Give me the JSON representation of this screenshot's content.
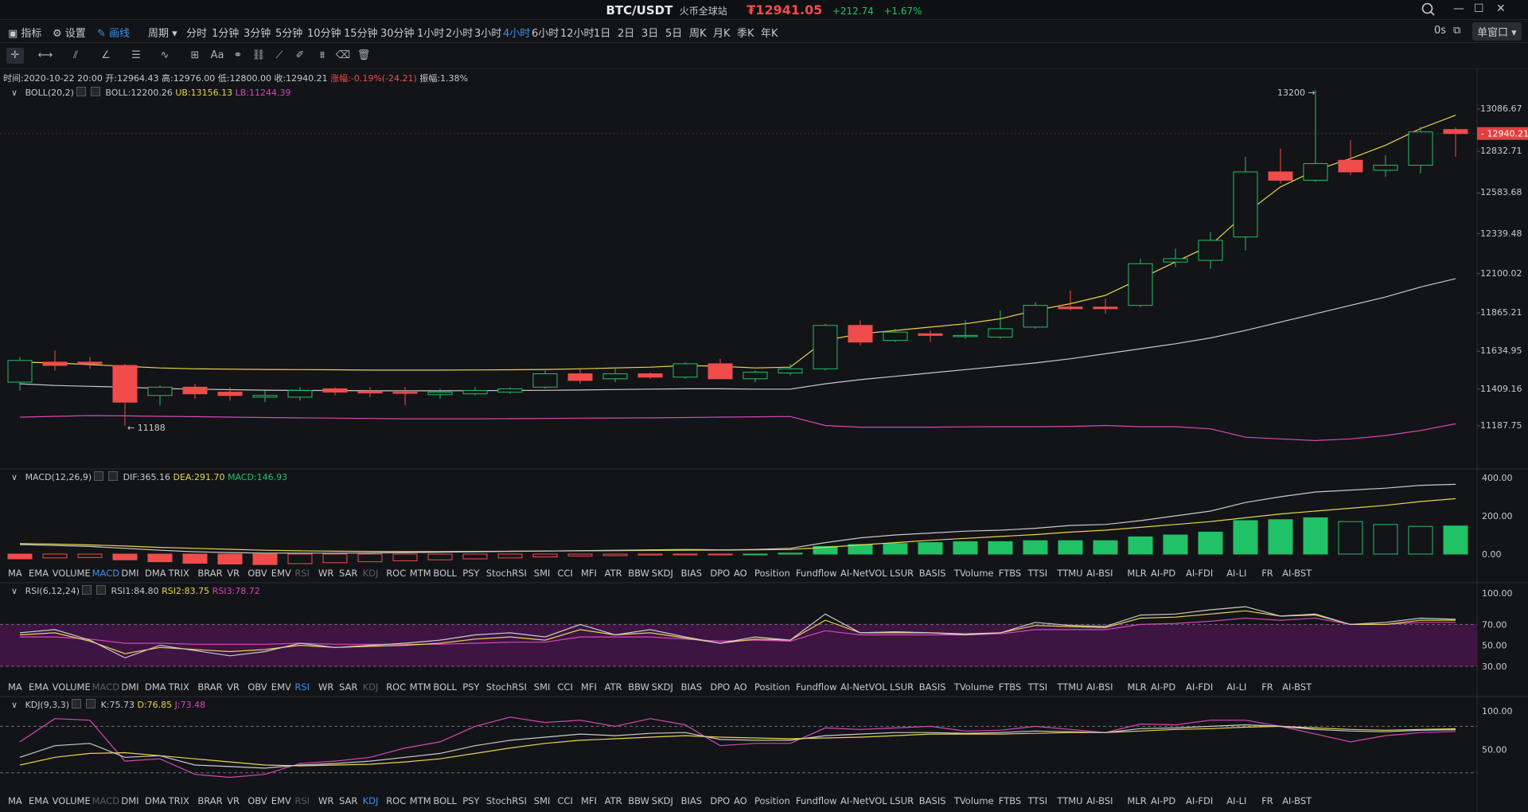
{
  "header": {
    "pair": "BTC/USDT",
    "exchange": "火币全球站",
    "price": "₮12941.05",
    "change": "+212.74",
    "change_pct": "+1.67%"
  },
  "toolbar": {
    "indicators": "指标",
    "settings": "设置",
    "draw": "画线",
    "period": "周期",
    "periods": [
      "分时",
      "1分钟",
      "3分钟",
      "5分钟",
      "10分钟",
      "15分钟",
      "30分钟",
      "1小时",
      "2小时",
      "3小时",
      "4小时",
      "6小时",
      "12小时",
      "1日",
      "2日",
      "3日",
      "5日",
      "周K",
      "月K",
      "季K",
      "年K"
    ],
    "active_period": "4小时",
    "timer": "0s",
    "window_mode": "单窗口"
  },
  "info_bar": {
    "time": "时间:2020-10-22 20:00",
    "open": "开:12964.43",
    "high": "高:12976.00",
    "low": "低:12800.00",
    "close": "收:12940.21",
    "change": "涨幅:-0.19%(-24.21)",
    "amplitude": "振幅:1.38%"
  },
  "boll": {
    "name": "BOLL(20,2)",
    "mid": "BOLL:12200.26",
    "ub": "UB:13156.13",
    "lb": "LB:11244.39",
    "high_marker": "13200",
    "low_marker": "11188",
    "current_price": "12940.21",
    "axis": [
      "13086.67",
      "12832.71",
      "12583.68",
      "12339.48",
      "12100.02",
      "11865.21",
      "11634.95",
      "11409.16",
      "11187.75"
    ]
  },
  "macd": {
    "name": "MACD(12,26,9)",
    "dif": "DIF:365.16",
    "dea": "DEA:291.70",
    "macd": "MACD:146.93",
    "axis": [
      "400.00",
      "200.00",
      "0.00"
    ]
  },
  "rsi": {
    "name": "RSI(6,12,24)",
    "rsi1": "RSI1:84.80",
    "rsi2": "RSI2:83.75",
    "rsi3": "RSI3:78.72",
    "axis": [
      "100.00",
      "70.00",
      "50.00",
      "30.00"
    ]
  },
  "kdj": {
    "name": "KDJ(9,3,3)",
    "k": "K:75.73",
    "d": "D:76.85",
    "j": "J:73.48",
    "axis": [
      "100.00",
      "50.00"
    ]
  },
  "indicator_tabs": [
    "MA",
    "EMA",
    "VOLUME",
    "MACD",
    "DMI",
    "DMA",
    "TRIX",
    "BRAR",
    "VR",
    "OBV",
    "EMV",
    "RSI",
    "WR",
    "SAR",
    "KDJ",
    "ROC",
    "MTM",
    "BOLL",
    "PSY",
    "StochRSI",
    "SMI",
    "CCI",
    "MFI",
    "ATR",
    "BBW",
    "SKDJ",
    "BIAS",
    "DPO",
    "AO",
    "Position",
    "Fundflow",
    "AI-NetVOL",
    "LSUR",
    "BASIS",
    "TVolume",
    "FTBS",
    "TTSI",
    "TTMU",
    "AI-BSI",
    "MLR",
    "AI-PD",
    "AI-FDI",
    "AI-LI",
    "FR",
    "AI-BST"
  ],
  "colors": {
    "up": "#20c167",
    "down": "#f04c4c",
    "mid": "#e8d44d",
    "upper": "#c8cace",
    "lower": "#d648b8",
    "accent": "#3c8ff0"
  },
  "candles": [
    {
      "o": 11450,
      "h": 11600,
      "l": 11400,
      "c": 11580
    },
    {
      "o": 11570,
      "h": 11640,
      "l": 11520,
      "c": 11550
    },
    {
      "o": 11570,
      "h": 11600,
      "l": 11530,
      "c": 11560
    },
    {
      "o": 11550,
      "h": 11560,
      "l": 11188,
      "c": 11330
    },
    {
      "o": 11370,
      "h": 11430,
      "l": 11310,
      "c": 11420
    },
    {
      "o": 11420,
      "h": 11440,
      "l": 11350,
      "c": 11380
    },
    {
      "o": 11390,
      "h": 11420,
      "l": 11340,
      "c": 11370
    },
    {
      "o": 11360,
      "h": 11400,
      "l": 11330,
      "c": 11370
    },
    {
      "o": 11360,
      "h": 11420,
      "l": 11340,
      "c": 11400
    },
    {
      "o": 11410,
      "h": 11420,
      "l": 11370,
      "c": 11390
    },
    {
      "o": 11395,
      "h": 11420,
      "l": 11360,
      "c": 11385
    },
    {
      "o": 11390,
      "h": 11420,
      "l": 11310,
      "c": 11385
    },
    {
      "o": 11375,
      "h": 11410,
      "l": 11350,
      "c": 11390
    },
    {
      "o": 11380,
      "h": 11420,
      "l": 11370,
      "c": 11400
    },
    {
      "o": 11390,
      "h": 11420,
      "l": 11380,
      "c": 11410
    },
    {
      "o": 11420,
      "h": 11520,
      "l": 11410,
      "c": 11500
    },
    {
      "o": 11500,
      "h": 11530,
      "l": 11440,
      "c": 11460
    },
    {
      "o": 11470,
      "h": 11540,
      "l": 11450,
      "c": 11500
    },
    {
      "o": 11500,
      "h": 11510,
      "l": 11470,
      "c": 11480
    },
    {
      "o": 11480,
      "h": 11570,
      "l": 11470,
      "c": 11560
    },
    {
      "o": 11560,
      "h": 11590,
      "l": 11470,
      "c": 11470
    },
    {
      "o": 11470,
      "h": 11520,
      "l": 11450,
      "c": 11510
    },
    {
      "o": 11505,
      "h": 11560,
      "l": 11490,
      "c": 11530
    },
    {
      "o": 11530,
      "h": 11800,
      "l": 11520,
      "c": 11790
    },
    {
      "o": 11790,
      "h": 11820,
      "l": 11670,
      "c": 11690
    },
    {
      "o": 11700,
      "h": 11770,
      "l": 11690,
      "c": 11750
    },
    {
      "o": 11740,
      "h": 11760,
      "l": 11690,
      "c": 11730
    },
    {
      "o": 11730,
      "h": 11820,
      "l": 11710,
      "c": 11730
    },
    {
      "o": 11720,
      "h": 11880,
      "l": 11710,
      "c": 11770
    },
    {
      "o": 11780,
      "h": 11930,
      "l": 11770,
      "c": 11910
    },
    {
      "o": 11900,
      "h": 12000,
      "l": 11880,
      "c": 11890
    },
    {
      "o": 11900,
      "h": 11950,
      "l": 11860,
      "c": 11890
    },
    {
      "o": 11910,
      "h": 12190,
      "l": 11900,
      "c": 12160
    },
    {
      "o": 12170,
      "h": 12250,
      "l": 12140,
      "c": 12190
    },
    {
      "o": 12180,
      "h": 12350,
      "l": 12130,
      "c": 12300
    },
    {
      "o": 12320,
      "h": 12800,
      "l": 12240,
      "c": 12710
    },
    {
      "o": 12710,
      "h": 12850,
      "l": 12640,
      "c": 12660
    },
    {
      "o": 12660,
      "h": 13200,
      "l": 12650,
      "c": 12760
    },
    {
      "o": 12780,
      "h": 12900,
      "l": 12690,
      "c": 12710
    },
    {
      "o": 12720,
      "h": 12810,
      "l": 12680,
      "c": 12750
    },
    {
      "o": 12750,
      "h": 12980,
      "l": 12700,
      "c": 12950
    },
    {
      "o": 12964,
      "h": 12976,
      "l": 12800,
      "c": 12940
    }
  ],
  "boll_mid": [
    11570,
    11565,
    11555,
    11545,
    11535,
    11530,
    11528,
    11526,
    11525,
    11524,
    11522,
    11522,
    11522,
    11523,
    11524,
    11526,
    11530,
    11535,
    11540,
    11550,
    11545,
    11535,
    11540,
    11700,
    11740,
    11760,
    11780,
    11800,
    11830,
    11880,
    11920,
    11970,
    12070,
    12170,
    12270,
    12460,
    12620,
    12720,
    12790,
    12870,
    12970,
    13050
  ],
  "boll_upper": [
    11440,
    11430,
    11425,
    11420,
    11412,
    11408,
    11405,
    11402,
    11400,
    11400,
    11398,
    11398,
    11398,
    11399,
    11400,
    11401,
    11403,
    11406,
    11408,
    11410,
    11410,
    11408,
    11408,
    11440,
    11465,
    11485,
    11505,
    11525,
    11545,
    11565,
    11590,
    11620,
    11650,
    11680,
    11715,
    11760,
    11810,
    11860,
    11910,
    11960,
    12020,
    12070
  ],
  "boll_lower": [
    11240,
    11245,
    11250,
    11248,
    11245,
    11243,
    11240,
    11238,
    11236,
    11234,
    11232,
    11230,
    11230,
    11230,
    11231,
    11232,
    11234,
    11235,
    11236,
    11238,
    11240,
    11242,
    11244,
    11190,
    11180,
    11180,
    11180,
    11182,
    11183,
    11183,
    11185,
    11190,
    11183,
    11183,
    11170,
    11120,
    11110,
    11100,
    11110,
    11130,
    11160,
    11200
  ],
  "macd_hist": [
    -25,
    -20,
    -18,
    -30,
    -40,
    -48,
    -52,
    -55,
    -50,
    -45,
    -40,
    -35,
    -30,
    -25,
    -20,
    -15,
    -10,
    -8,
    -5,
    -3,
    -2,
    0,
    5,
    40,
    50,
    55,
    60,
    65,
    65,
    70,
    70,
    70,
    90,
    100,
    115,
    175,
    180,
    190,
    170,
    155,
    145,
    147
  ],
  "macd_dif": [
    50,
    45,
    40,
    30,
    20,
    12,
    8,
    5,
    5,
    5,
    6,
    8,
    10,
    12,
    14,
    16,
    18,
    20,
    22,
    24,
    22,
    24,
    30,
    60,
    85,
    100,
    110,
    120,
    125,
    135,
    150,
    155,
    175,
    200,
    225,
    270,
    300,
    325,
    335,
    345,
    360,
    365
  ],
  "macd_dea": [
    55,
    52,
    48,
    42,
    35,
    30,
    25,
    20,
    17,
    15,
    14,
    13,
    13,
    14,
    15,
    16,
    17,
    18,
    19,
    20,
    21,
    22,
    24,
    35,
    48,
    60,
    72,
    82,
    92,
    102,
    115,
    125,
    140,
    155,
    170,
    190,
    210,
    225,
    240,
    255,
    275,
    290
  ],
  "rsi1": [
    62,
    65,
    55,
    38,
    50,
    45,
    40,
    44,
    52,
    48,
    50,
    52,
    55,
    60,
    62,
    58,
    70,
    60,
    65,
    58,
    52,
    58,
    55,
    80,
    62,
    63,
    62,
    60,
    62,
    72,
    69,
    68,
    79,
    80,
    84,
    87,
    78,
    80,
    70,
    72,
    76,
    75
  ],
  "rsi2": [
    60,
    62,
    54,
    42,
    48,
    46,
    44,
    46,
    50,
    48,
    49,
    50,
    52,
    56,
    58,
    55,
    65,
    60,
    62,
    57,
    52,
    56,
    55,
    74,
    62,
    62,
    62,
    61,
    62,
    69,
    68,
    67,
    76,
    77,
    80,
    83,
    78,
    79,
    70,
    70,
    74,
    74
  ],
  "rsi3": [
    58,
    58,
    56,
    52,
    52,
    51,
    51,
    51,
    52,
    51,
    51,
    51,
    51,
    52,
    53,
    53,
    58,
    58,
    58,
    56,
    54,
    55,
    54,
    64,
    60,
    60,
    60,
    60,
    61,
    65,
    65,
    65,
    70,
    71,
    73,
    76,
    74,
    76,
    70,
    70,
    72,
    72
  ],
  "kdj_k": [
    40,
    55,
    58,
    40,
    42,
    30,
    28,
    26,
    30,
    32,
    35,
    40,
    45,
    55,
    62,
    66,
    70,
    68,
    71,
    72,
    63,
    62,
    62,
    68,
    70,
    72,
    72,
    71,
    72,
    74,
    73,
    72,
    77,
    78,
    80,
    82,
    80,
    76,
    74,
    73,
    75,
    75.73
  ],
  "kdj_d": [
    30,
    40,
    45,
    46,
    42,
    38,
    34,
    30,
    29,
    30,
    31,
    34,
    38,
    45,
    52,
    58,
    62,
    64,
    66,
    68,
    66,
    65,
    64,
    65,
    66,
    68,
    70,
    70,
    70,
    71,
    72,
    72,
    74,
    76,
    77,
    79,
    80,
    78,
    76,
    75,
    76,
    76.85
  ],
  "kdj_j": [
    60,
    90,
    88,
    35,
    38,
    18,
    14,
    18,
    32,
    35,
    40,
    52,
    60,
    80,
    92,
    85,
    88,
    80,
    90,
    82,
    55,
    58,
    58,
    78,
    76,
    78,
    80,
    74,
    75,
    80,
    76,
    72,
    83,
    82,
    88,
    88,
    80,
    70,
    60,
    68,
    72,
    73.48
  ]
}
